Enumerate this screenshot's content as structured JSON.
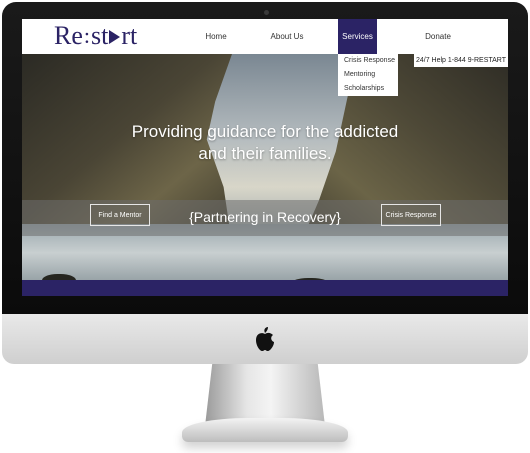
{
  "site": {
    "logo": {
      "left": "Re",
      "right": "st",
      "tail": "rt"
    },
    "nav": [
      {
        "label": "Home"
      },
      {
        "label": "About Us"
      },
      {
        "label": "Services"
      },
      {
        "label": "Donate"
      }
    ],
    "services_menu": [
      {
        "label": "Crisis Response"
      },
      {
        "label": "Mentoring"
      },
      {
        "label": "Scholarships"
      }
    ],
    "helpline": "24/7 Help 1-844 9-RESTART"
  },
  "hero": {
    "headline_line1": "Providing guidance for the addicted",
    "headline_line2": "and their families.",
    "tagline": "{Partnering in Recovery}",
    "buttons": {
      "mentor": "Find a Mentor",
      "crisis": "Crisis Response"
    }
  },
  "colors": {
    "brand": "#2b2365",
    "text": "#333333"
  },
  "icons": {
    "hardware_logo": "apple-logo-icon",
    "camera": "camera-dot-icon"
  }
}
